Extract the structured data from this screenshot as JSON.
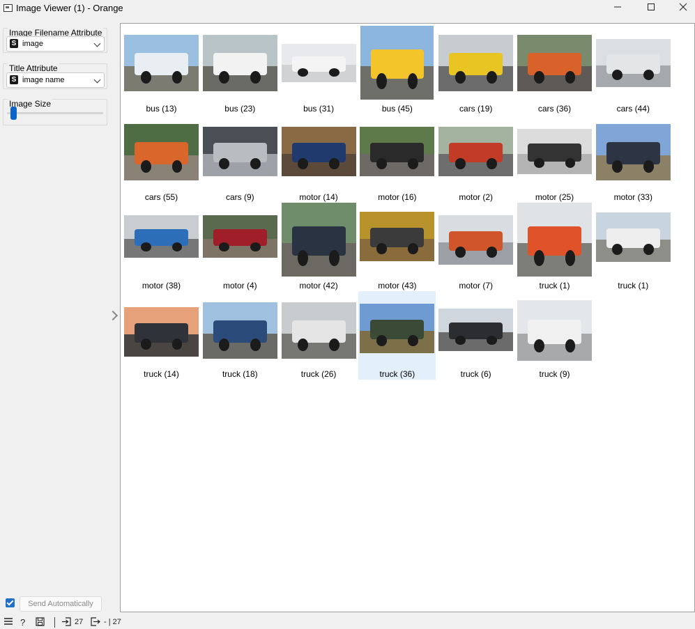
{
  "window": {
    "title": "Image Viewer (1) - Orange"
  },
  "controls": {
    "filename_attr_label": "Image Filename Attribute",
    "filename_attr_value": "image",
    "title_attr_label": "Title Attribute",
    "title_attr_value": "image name",
    "image_size_label": "Image Size",
    "image_size_level": 0.05,
    "send_automatically_label": "Send Automatically",
    "send_automatically_checked": true
  },
  "status": {
    "input_count": "27",
    "output_count": "- | 27"
  },
  "images": [
    {
      "title": "bus (13)",
      "sky": "#9bbfe0",
      "ground": "#7b7b72",
      "body": "#e9eef2"
    },
    {
      "title": "bus (23)",
      "sky": "#b9c4c9",
      "ground": "#6b6b65",
      "body": "#f2f2f2"
    },
    {
      "title": "bus (31)",
      "sky": "#e7e9ec",
      "ground": "#d0d2d4",
      "body": "#f4f4f4"
    },
    {
      "title": "bus (45)",
      "sky": "#8cb6dd",
      "ground": "#6f6f6a",
      "body": "#f3c52a"
    },
    {
      "title": "cars (19)",
      "sky": "#c7ccd1",
      "ground": "#6c6c6c",
      "body": "#e8c522"
    },
    {
      "title": "cars (36)",
      "sky": "#7a8a6d",
      "ground": "#5f5a55",
      "body": "#d9622b"
    },
    {
      "title": "cars (44)",
      "sky": "#dcdfe2",
      "ground": "#a5a9ad",
      "body": "#e3e5e7"
    },
    {
      "title": "cars (55)",
      "sky": "#4f6d44",
      "ground": "#8a8275",
      "body": "#d9662a"
    },
    {
      "title": "cars (9)",
      "sky": "#4a4e55",
      "ground": "#9ea2a8",
      "body": "#b9bcc0"
    },
    {
      "title": "motor (14)",
      "sky": "#8a6a45",
      "ground": "#5b4a3a",
      "body": "#203a6e"
    },
    {
      "title": "motor (16)",
      "sky": "#5f7a4a",
      "ground": "#6d6a66",
      "body": "#2a2a2a"
    },
    {
      "title": "motor (2)",
      "sky": "#a4b2a0",
      "ground": "#6e6e6e",
      "body": "#c23b27"
    },
    {
      "title": "motor (25)",
      "sky": "#dcdcdc",
      "ground": "#b4b4b4",
      "body": "#333333"
    },
    {
      "title": "motor (33)",
      "sky": "#7fa6d6",
      "ground": "#8c8166",
      "body": "#2d3444"
    },
    {
      "title": "motor (38)",
      "sky": "#c9ccd0",
      "ground": "#777777",
      "body": "#2c6fb8"
    },
    {
      "title": "motor (4)",
      "sky": "#5a6a4e",
      "ground": "#7d7466",
      "body": "#a01d2a"
    },
    {
      "title": "motor (42)",
      "sky": "#6f8c6b",
      "ground": "#6b6962",
      "body": "#2a3342"
    },
    {
      "title": "motor (43)",
      "sky": "#b8922a",
      "ground": "#8a6c3c",
      "body": "#3b3b3b"
    },
    {
      "title": "motor (7)",
      "sky": "#d8dde2",
      "ground": "#9aa0a5",
      "body": "#d1552a"
    },
    {
      "title": "truck (1)",
      "sky": "#dfe3e6",
      "ground": "#7e7e78",
      "body": "#e0522a"
    },
    {
      "title": "truck (1)",
      "sky": "#c8d4df",
      "ground": "#8e8e88",
      "body": "#eeeeee"
    },
    {
      "title": "truck (14)",
      "sky": "#e6a17a",
      "ground": "#4a4540",
      "body": "#2f3238"
    },
    {
      "title": "truck (18)",
      "sky": "#9fc0df",
      "ground": "#6a6a66",
      "body": "#2b4b7a"
    },
    {
      "title": "truck (26)",
      "sky": "#c9ccce",
      "ground": "#777774",
      "body": "#e5e5e5"
    },
    {
      "title": "truck (36)",
      "sky": "#6f9bd3",
      "ground": "#7d6f48",
      "body": "#3a4a36"
    },
    {
      "title": "truck (6)",
      "sky": "#cfd6dd",
      "ground": "#6b6b6b",
      "body": "#2b2d30"
    },
    {
      "title": "truck (9)",
      "sky": "#e3e6ea",
      "ground": "#a7a9ab",
      "body": "#f0f0f0"
    }
  ],
  "selected_title": "truck (36)"
}
